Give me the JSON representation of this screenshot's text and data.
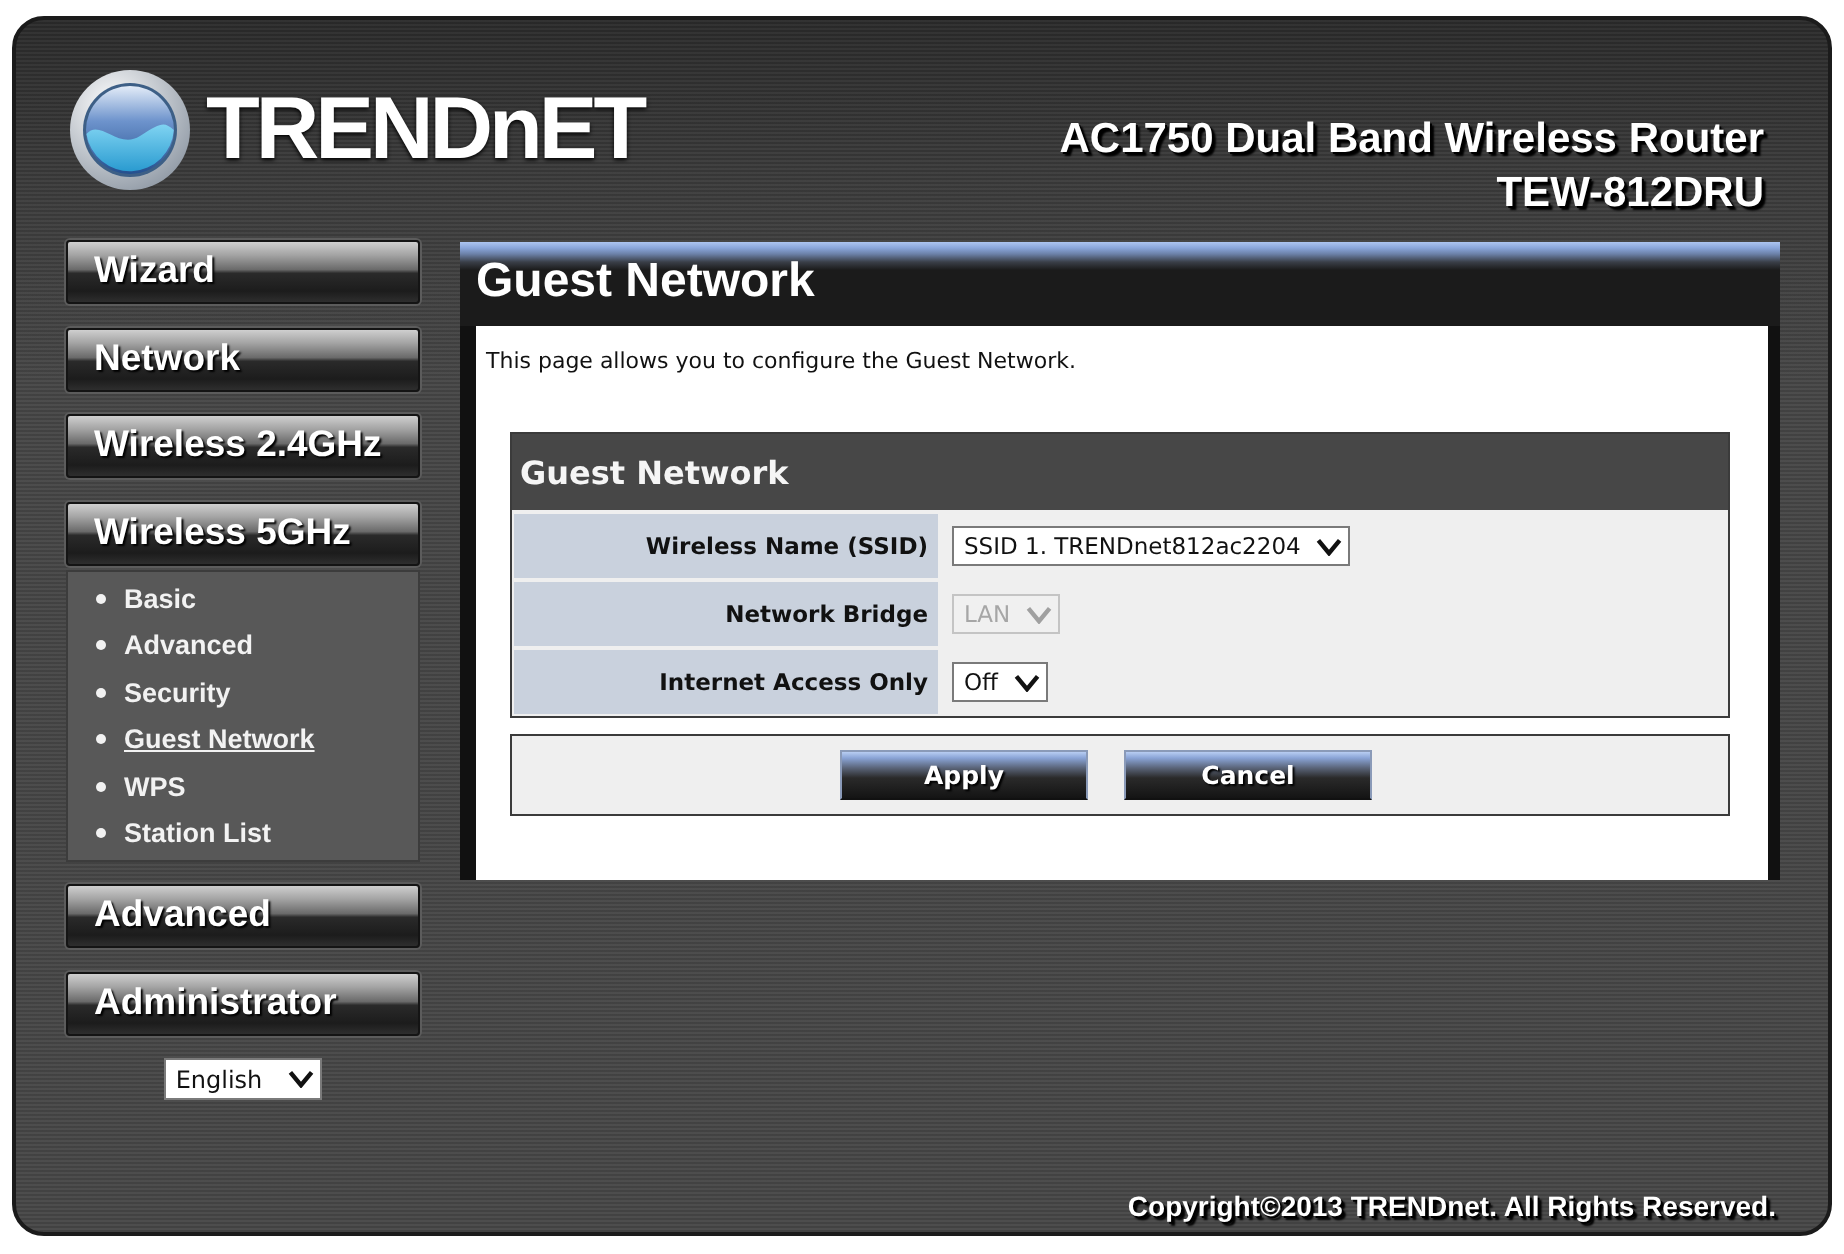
{
  "header": {
    "logo_text": "TRENDnET",
    "product_name": "AC1750 Dual Band Wireless Router",
    "model": "TEW-812DRU"
  },
  "sidebar": {
    "menu": [
      {
        "label": "Wizard"
      },
      {
        "label": "Network"
      },
      {
        "label": "Wireless 2.4GHz"
      },
      {
        "label": "Wireless 5GHz",
        "children": [
          {
            "label": "Basic",
            "selected": false
          },
          {
            "label": "Advanced",
            "selected": false
          },
          {
            "label": "Security",
            "selected": false
          },
          {
            "label": "Guest Network",
            "selected": true
          },
          {
            "label": "WPS",
            "selected": false
          },
          {
            "label": "Station List",
            "selected": false
          }
        ]
      },
      {
        "label": "Advanced"
      },
      {
        "label": "Administrator"
      }
    ],
    "language": {
      "value": "English"
    }
  },
  "content": {
    "title": "Guest Network",
    "description": "This page allows you to configure the Guest Network.",
    "section": {
      "title": "Guest Network",
      "fields": [
        {
          "label": "Wireless Name (SSID)",
          "value": "SSID 1. TRENDnet812ac2204",
          "disabled": false
        },
        {
          "label": "Network Bridge",
          "value": "LAN",
          "disabled": true
        },
        {
          "label": "Internet Access Only",
          "value": "Off",
          "disabled": false
        }
      ]
    },
    "buttons": [
      "Apply",
      "Cancel"
    ]
  },
  "footer": {
    "copyright": "Copyright©2013 TRENDnet. All Rights Reserved."
  }
}
